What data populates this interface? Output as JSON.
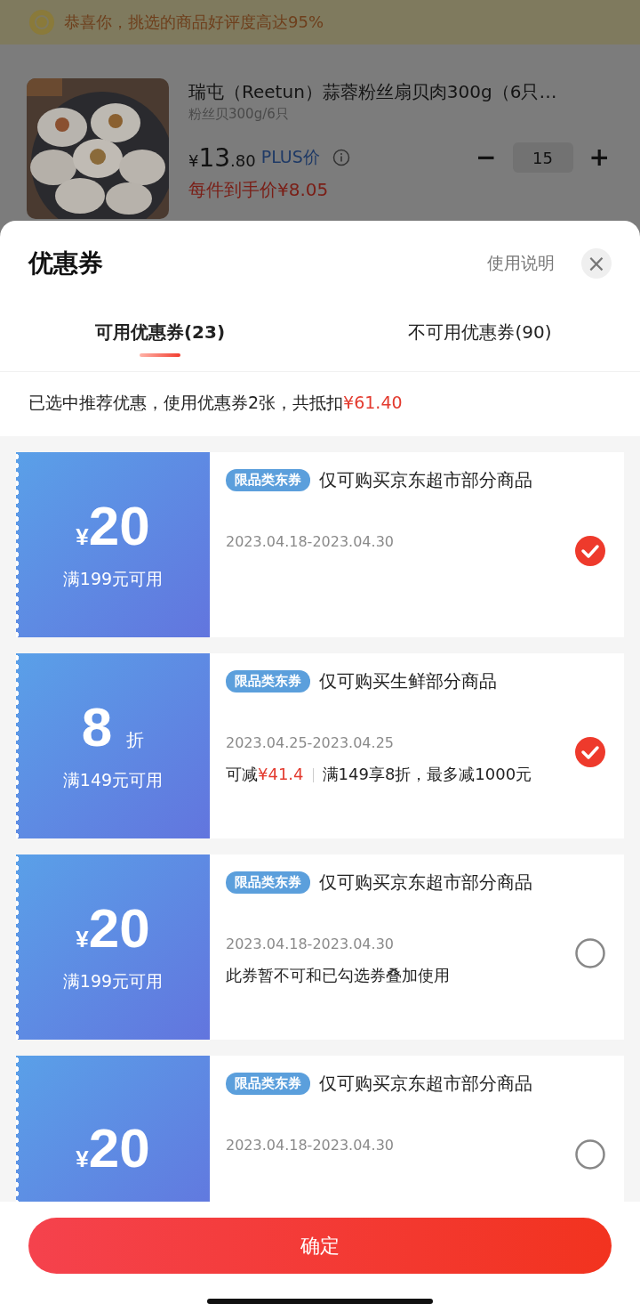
{
  "banner": {
    "text": "恭喜你，挑选的商品好评度高达95%"
  },
  "product": {
    "title": "瑞屯（Reetun）蒜蓉粉丝扇贝肉300g（6只…",
    "spec": "粉丝贝300g/6只",
    "currency": "¥",
    "price_int": "13",
    "price_dec": ".80",
    "price_label": "PLUS价",
    "final_price": "每件到手价¥8.05",
    "quantity": "15",
    "minus": "−",
    "plus": "+"
  },
  "sheet": {
    "title": "优惠券",
    "help": "使用说明",
    "close": "×"
  },
  "tabs": [
    {
      "label": "可用优惠券(23)",
      "selected": true
    },
    {
      "label": "不可用优惠券(90)",
      "selected": false
    }
  ],
  "summary": {
    "text": "已选中推荐优惠，使用优惠券2张，共抵扣",
    "amount": "¥61.40"
  },
  "coupons": [
    {
      "kind": "amount",
      "currency": "¥",
      "value": "20",
      "condition": "满199元可用",
      "tag": "限品类东券",
      "title": "仅可购买京东超市部分商品",
      "dates": "2023.04.18-2023.04.30",
      "selected": true
    },
    {
      "kind": "discount",
      "value": "8",
      "unit": "折",
      "condition": "满149元可用",
      "tag": "限品类东券",
      "title": "仅可购买生鲜部分商品",
      "dates": "2023.04.25-2023.04.25",
      "saving_label": "可减",
      "saving_amount": "¥41.4",
      "rule": "满149享8折，最多减1000元",
      "selected": true
    },
    {
      "kind": "amount",
      "currency": "¥",
      "value": "20",
      "condition": "满199元可用",
      "tag": "限品类东券",
      "title": "仅可购买京东超市部分商品",
      "dates": "2023.04.18-2023.04.30",
      "note": "此券暂不可和已勾选券叠加使用",
      "selected": false
    },
    {
      "kind": "amount",
      "currency": "¥",
      "value": "20",
      "tag": "限品类东券",
      "title": "仅可购买京东超市部分商品",
      "dates": "2023.04.18-2023.04.30",
      "selected": false
    }
  ],
  "confirm": "确定"
}
